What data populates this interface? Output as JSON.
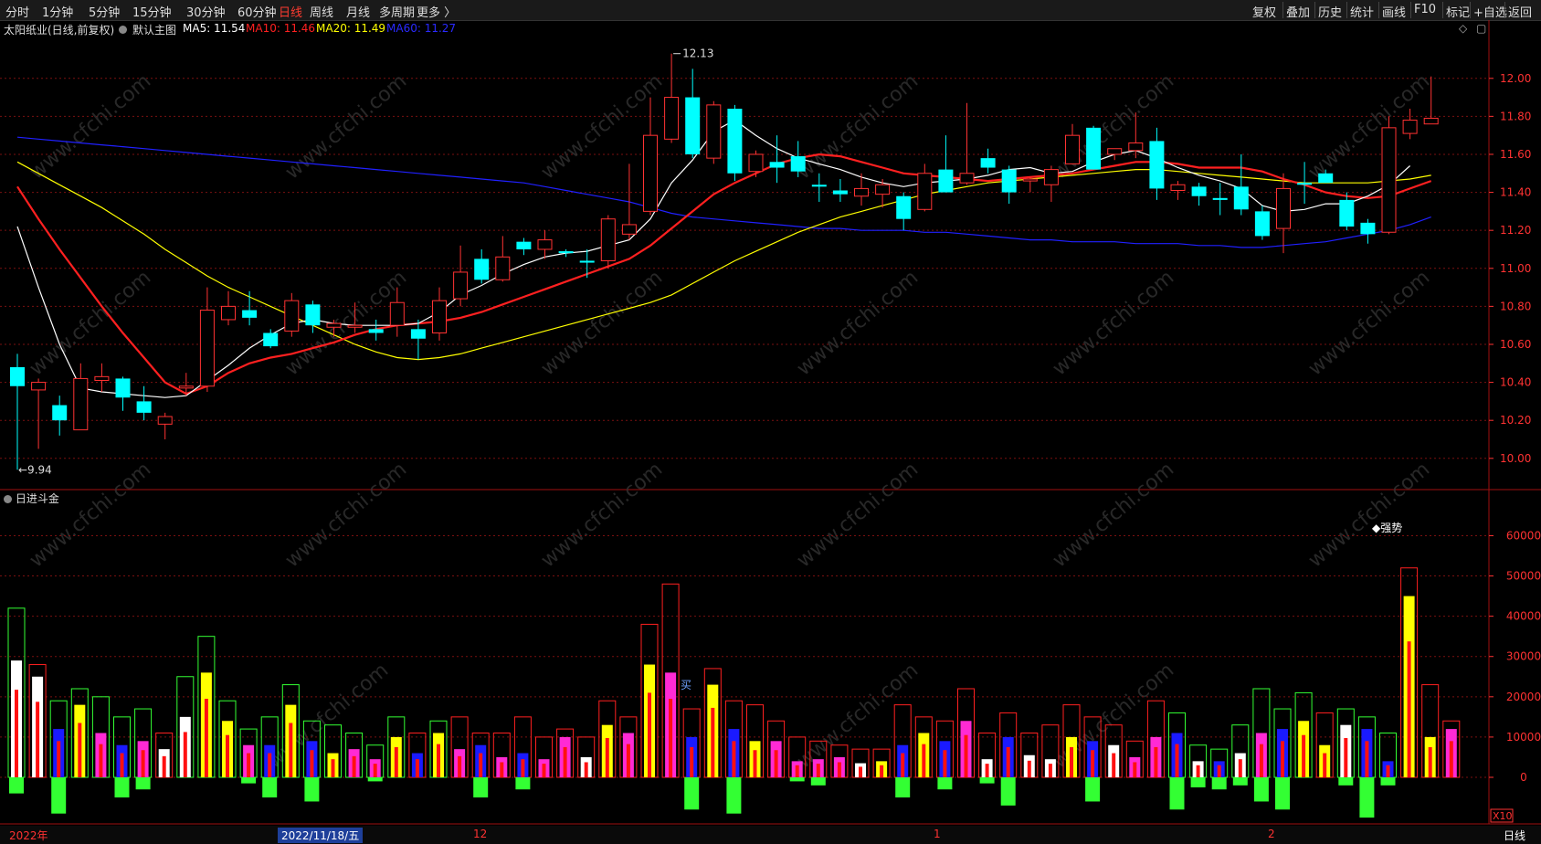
{
  "toolbar": {
    "periods": [
      "分时",
      "1分钟",
      "5分钟",
      "15分钟",
      "30分钟",
      "60分钟",
      "日线",
      "周线",
      "月线",
      "多周期",
      "更多 〉"
    ],
    "active_period": "日线",
    "right_items": [
      "复权",
      "叠加",
      "历史",
      "统计",
      "画线",
      "F10",
      "标记",
      "+自选",
      "返回"
    ]
  },
  "info": {
    "stock": "太阳纸业(日线,前复权)",
    "main_chart": "默认主图",
    "ma5": "MA5: 11.54",
    "ma10": "MA10: 11.46",
    "ma20": "MA20: 11.49",
    "ma60": "MA60: 11.27"
  },
  "colors": {
    "up": "#ff3232",
    "down": "#00ffff",
    "ma5": "#ffffff",
    "ma10": "#ff2020",
    "ma20": "#ffff00",
    "ma60": "#2020ff",
    "grid": "#7a1010",
    "axis": "#ff3232"
  },
  "price_axis": {
    "labels": [
      "12.00",
      "11.80",
      "11.60",
      "11.40",
      "11.20",
      "11.00",
      "10.80",
      "10.60",
      "10.40",
      "10.20",
      "10.00"
    ],
    "max_label": "12.13",
    "min_label": "9.94"
  },
  "indicator": {
    "title": "日进斗金",
    "axis_labels": [
      "60000",
      "50000",
      "40000",
      "30000",
      "20000",
      "10000",
      "0"
    ],
    "strong_label": "◆强势",
    "buy_label": "买"
  },
  "bottom": {
    "year": "2022年",
    "selected_date": "2022/11/18/五",
    "month_12": "12",
    "month_1": "1",
    "month_2": "2",
    "x10": "X10",
    "period": "日线"
  },
  "watermark": "www.cfchi.com",
  "chart_data": {
    "type": "candlestick",
    "ylim": [
      9.85,
      12.22
    ],
    "candles": [
      {
        "o": 10.48,
        "h": 10.55,
        "l": 9.94,
        "c": 10.38
      },
      {
        "o": 10.36,
        "h": 10.42,
        "l": 10.05,
        "c": 10.4
      },
      {
        "o": 10.28,
        "h": 10.33,
        "l": 10.12,
        "c": 10.2
      },
      {
        "o": 10.15,
        "h": 10.5,
        "l": 10.15,
        "c": 10.42
      },
      {
        "o": 10.41,
        "h": 10.5,
        "l": 10.35,
        "c": 10.43
      },
      {
        "o": 10.42,
        "h": 10.43,
        "l": 10.25,
        "c": 10.32
      },
      {
        "o": 10.3,
        "h": 10.38,
        "l": 10.2,
        "c": 10.24
      },
      {
        "o": 10.18,
        "h": 10.24,
        "l": 10.1,
        "c": 10.22
      },
      {
        "o": 10.37,
        "h": 10.45,
        "l": 10.33,
        "c": 10.38
      },
      {
        "o": 10.38,
        "h": 10.9,
        "l": 10.35,
        "c": 10.78
      },
      {
        "o": 10.73,
        "h": 10.88,
        "l": 10.7,
        "c": 10.8
      },
      {
        "o": 10.78,
        "h": 10.88,
        "l": 10.7,
        "c": 10.74
      },
      {
        "o": 10.66,
        "h": 10.68,
        "l": 10.58,
        "c": 10.59
      },
      {
        "o": 10.67,
        "h": 10.87,
        "l": 10.64,
        "c": 10.83
      },
      {
        "o": 10.81,
        "h": 10.83,
        "l": 10.66,
        "c": 10.7
      },
      {
        "o": 10.69,
        "h": 10.73,
        "l": 10.64,
        "c": 10.71
      },
      {
        "o": 10.69,
        "h": 10.82,
        "l": 10.66,
        "c": 10.7
      },
      {
        "o": 10.68,
        "h": 10.73,
        "l": 10.62,
        "c": 10.66
      },
      {
        "o": 10.7,
        "h": 10.9,
        "l": 10.64,
        "c": 10.82
      },
      {
        "o": 10.68,
        "h": 10.73,
        "l": 10.52,
        "c": 10.63
      },
      {
        "o": 10.66,
        "h": 10.9,
        "l": 10.62,
        "c": 10.83
      },
      {
        "o": 10.84,
        "h": 11.12,
        "l": 10.8,
        "c": 10.98
      },
      {
        "o": 11.05,
        "h": 11.1,
        "l": 10.92,
        "c": 10.94
      },
      {
        "o": 10.94,
        "h": 11.17,
        "l": 10.93,
        "c": 11.06
      },
      {
        "o": 11.14,
        "h": 11.16,
        "l": 11.07,
        "c": 11.1
      },
      {
        "o": 11.1,
        "h": 11.2,
        "l": 11.05,
        "c": 11.15
      },
      {
        "o": 11.09,
        "h": 11.1,
        "l": 11.06,
        "c": 11.08
      },
      {
        "o": 11.04,
        "h": 11.1,
        "l": 10.95,
        "c": 11.03
      },
      {
        "o": 11.04,
        "h": 11.28,
        "l": 11.0,
        "c": 11.26
      },
      {
        "o": 11.18,
        "h": 11.55,
        "l": 11.15,
        "c": 11.23
      },
      {
        "o": 11.3,
        "h": 11.9,
        "l": 11.28,
        "c": 11.7
      },
      {
        "o": 11.68,
        "h": 12.13,
        "l": 11.66,
        "c": 11.9
      },
      {
        "o": 11.9,
        "h": 12.05,
        "l": 11.58,
        "c": 11.6
      },
      {
        "o": 11.58,
        "h": 11.88,
        "l": 11.55,
        "c": 11.86
      },
      {
        "o": 11.84,
        "h": 11.86,
        "l": 11.46,
        "c": 11.5
      },
      {
        "o": 11.51,
        "h": 11.62,
        "l": 11.48,
        "c": 11.6
      },
      {
        "o": 11.56,
        "h": 11.7,
        "l": 11.45,
        "c": 11.53
      },
      {
        "o": 11.59,
        "h": 11.67,
        "l": 11.48,
        "c": 11.51
      },
      {
        "o": 11.44,
        "h": 11.5,
        "l": 11.35,
        "c": 11.43
      },
      {
        "o": 11.41,
        "h": 11.47,
        "l": 11.35,
        "c": 11.39
      },
      {
        "o": 11.38,
        "h": 11.5,
        "l": 11.33,
        "c": 11.42
      },
      {
        "o": 11.39,
        "h": 11.47,
        "l": 11.32,
        "c": 11.44
      },
      {
        "o": 11.38,
        "h": 11.4,
        "l": 11.2,
        "c": 11.26
      },
      {
        "o": 11.31,
        "h": 11.55,
        "l": 11.3,
        "c": 11.5
      },
      {
        "o": 11.52,
        "h": 11.7,
        "l": 11.4,
        "c": 11.4
      },
      {
        "o": 11.45,
        "h": 11.87,
        "l": 11.44,
        "c": 11.5
      },
      {
        "o": 11.58,
        "h": 11.63,
        "l": 11.5,
        "c": 11.53
      },
      {
        "o": 11.52,
        "h": 11.54,
        "l": 11.34,
        "c": 11.4
      },
      {
        "o": 11.46,
        "h": 11.48,
        "l": 11.4,
        "c": 11.47
      },
      {
        "o": 11.44,
        "h": 11.54,
        "l": 11.35,
        "c": 11.52
      },
      {
        "o": 11.55,
        "h": 11.76,
        "l": 11.55,
        "c": 11.7
      },
      {
        "o": 11.74,
        "h": 11.75,
        "l": 11.52,
        "c": 11.52
      },
      {
        "o": 11.6,
        "h": 11.63,
        "l": 11.57,
        "c": 11.63
      },
      {
        "o": 11.62,
        "h": 11.82,
        "l": 11.58,
        "c": 11.66
      },
      {
        "o": 11.67,
        "h": 11.74,
        "l": 11.36,
        "c": 11.42
      },
      {
        "o": 11.41,
        "h": 11.46,
        "l": 11.36,
        "c": 11.44
      },
      {
        "o": 11.43,
        "h": 11.45,
        "l": 11.33,
        "c": 11.38
      },
      {
        "o": 11.37,
        "h": 11.45,
        "l": 11.28,
        "c": 11.36
      },
      {
        "o": 11.43,
        "h": 11.6,
        "l": 11.28,
        "c": 11.31
      },
      {
        "o": 11.3,
        "h": 11.33,
        "l": 11.15,
        "c": 11.17
      },
      {
        "o": 11.21,
        "h": 11.5,
        "l": 11.08,
        "c": 11.42
      },
      {
        "o": 11.45,
        "h": 11.56,
        "l": 11.34,
        "c": 11.44
      },
      {
        "o": 11.5,
        "h": 11.52,
        "l": 11.45,
        "c": 11.45
      },
      {
        "o": 11.36,
        "h": 11.4,
        "l": 11.2,
        "c": 11.22
      },
      {
        "o": 11.24,
        "h": 11.26,
        "l": 11.13,
        "c": 11.18
      },
      {
        "o": 11.19,
        "h": 11.8,
        "l": 11.18,
        "c": 11.74
      },
      {
        "o": 11.71,
        "h": 11.84,
        "l": 11.68,
        "c": 11.78
      },
      {
        "o": 11.76,
        "h": 12.01,
        "l": 11.76,
        "c": 11.79
      }
    ],
    "ma5": [
      11.22,
      10.9,
      10.6,
      10.37,
      10.35,
      10.34,
      10.33,
      10.32,
      10.33,
      10.41,
      10.49,
      10.58,
      10.65,
      10.71,
      10.73,
      10.71,
      10.7,
      10.7,
      10.7,
      10.71,
      10.77,
      10.86,
      10.91,
      10.97,
      11.02,
      11.06,
      11.08,
      11.09,
      11.12,
      11.15,
      11.26,
      11.45,
      11.57,
      11.72,
      11.78,
      11.7,
      11.63,
      11.58,
      11.55,
      11.52,
      11.48,
      11.45,
      11.43,
      11.45,
      11.46,
      11.47,
      11.49,
      11.52,
      11.53,
      11.5,
      11.51,
      11.56,
      11.6,
      11.62,
      11.58,
      11.53,
      11.49,
      11.46,
      11.42,
      11.33,
      11.3,
      11.31,
      11.34,
      11.34,
      11.38,
      11.44,
      11.54
    ],
    "ma10": [
      11.43,
      11.26,
      11.1,
      10.95,
      10.8,
      10.66,
      10.53,
      10.4,
      10.34,
      10.38,
      10.45,
      10.5,
      10.53,
      10.55,
      10.58,
      10.61,
      10.65,
      10.68,
      10.7,
      10.71,
      10.72,
      10.74,
      10.77,
      10.81,
      10.85,
      10.89,
      10.93,
      10.97,
      11.01,
      11.05,
      11.12,
      11.21,
      11.3,
      11.39,
      11.45,
      11.5,
      11.55,
      11.58,
      11.6,
      11.59,
      11.56,
      11.53,
      11.5,
      11.49,
      11.48,
      11.47,
      11.46,
      11.47,
      11.48,
      11.49,
      11.5,
      11.52,
      11.54,
      11.56,
      11.56,
      11.55,
      11.53,
      11.53,
      11.53,
      11.51,
      11.47,
      11.44,
      11.4,
      11.38,
      11.37,
      11.38,
      11.42,
      11.46
    ],
    "ma20": [
      11.56,
      11.5,
      11.44,
      11.38,
      11.32,
      11.25,
      11.18,
      11.1,
      11.03,
      10.96,
      10.9,
      10.85,
      10.8,
      10.75,
      10.7,
      10.65,
      10.6,
      10.56,
      10.53,
      10.52,
      10.53,
      10.55,
      10.58,
      10.61,
      10.64,
      10.67,
      10.7,
      10.73,
      10.76,
      10.79,
      10.82,
      10.86,
      10.92,
      10.98,
      11.04,
      11.09,
      11.14,
      11.19,
      11.23,
      11.27,
      11.3,
      11.33,
      11.36,
      11.39,
      11.41,
      11.43,
      11.45,
      11.46,
      11.47,
      11.48,
      11.49,
      11.5,
      11.51,
      11.52,
      11.52,
      11.51,
      11.5,
      11.49,
      11.48,
      11.47,
      11.46,
      11.45,
      11.45,
      11.45,
      11.45,
      11.46,
      11.47,
      11.49
    ],
    "ma60": [
      11.69,
      11.68,
      11.67,
      11.66,
      11.65,
      11.64,
      11.63,
      11.62,
      11.61,
      11.6,
      11.59,
      11.58,
      11.57,
      11.56,
      11.55,
      11.54,
      11.53,
      11.52,
      11.51,
      11.5,
      11.49,
      11.48,
      11.47,
      11.46,
      11.45,
      11.43,
      11.41,
      11.39,
      11.37,
      11.35,
      11.32,
      11.29,
      11.27,
      11.26,
      11.25,
      11.24,
      11.23,
      11.22,
      11.21,
      11.21,
      11.2,
      11.2,
      11.2,
      11.19,
      11.19,
      11.18,
      11.17,
      11.16,
      11.15,
      11.15,
      11.14,
      11.14,
      11.14,
      11.13,
      11.13,
      11.13,
      11.12,
      11.12,
      11.11,
      11.11,
      11.12,
      11.13,
      11.14,
      11.16,
      11.18,
      11.2,
      11.23,
      11.27
    ],
    "indicator_bars": [
      {
        "box": 42000,
        "boxc": "g",
        "in": 29000,
        "inc": "w",
        "neg": 4000
      },
      {
        "box": 28000,
        "boxc": "r",
        "in": 25000,
        "inc": "w",
        "neg": 0
      },
      {
        "box": 19000,
        "boxc": "g",
        "in": 12000,
        "inc": "b",
        "neg": 9000
      },
      {
        "box": 22000,
        "boxc": "g",
        "in": 18000,
        "inc": "y",
        "neg": 0
      },
      {
        "box": 20000,
        "boxc": "g",
        "in": 11000,
        "inc": "m",
        "neg": 0
      },
      {
        "box": 15000,
        "boxc": "g",
        "in": 8000,
        "inc": "b",
        "neg": 5000
      },
      {
        "box": 17000,
        "boxc": "g",
        "in": 9000,
        "inc": "m",
        "neg": 3000
      },
      {
        "box": 11000,
        "boxc": "r",
        "in": 7000,
        "inc": "w",
        "neg": 0
      },
      {
        "box": 25000,
        "boxc": "g",
        "in": 15000,
        "inc": "w",
        "neg": 0
      },
      {
        "box": 35000,
        "boxc": "g",
        "in": 26000,
        "inc": "y",
        "neg": 0
      },
      {
        "box": 19000,
        "boxc": "g",
        "in": 14000,
        "inc": "y",
        "neg": 0
      },
      {
        "box": 12000,
        "boxc": "g",
        "in": 8000,
        "inc": "m",
        "neg": 1500
      },
      {
        "box": 15000,
        "boxc": "g",
        "in": 8000,
        "inc": "b",
        "neg": 5000
      },
      {
        "box": 23000,
        "boxc": "g",
        "in": 18000,
        "inc": "y",
        "neg": 0
      },
      {
        "box": 14000,
        "boxc": "g",
        "in": 9000,
        "inc": "b",
        "neg": 6000
      },
      {
        "box": 13000,
        "boxc": "g",
        "in": 6000,
        "inc": "y",
        "neg": 0
      },
      {
        "box": 11000,
        "boxc": "g",
        "in": 7000,
        "inc": "m",
        "neg": 0
      },
      {
        "box": 8000,
        "boxc": "g",
        "in": 4500,
        "inc": "m",
        "neg": 1000
      },
      {
        "box": 15000,
        "boxc": "g",
        "in": 10000,
        "inc": "y",
        "neg": 0
      },
      {
        "box": 11000,
        "boxc": "r",
        "in": 6000,
        "inc": "b",
        "neg": 0
      },
      {
        "box": 14000,
        "boxc": "g",
        "in": 11000,
        "inc": "y",
        "neg": 0
      },
      {
        "box": 15000,
        "boxc": "r",
        "in": 7000,
        "inc": "m",
        "neg": 0
      },
      {
        "box": 11000,
        "boxc": "r",
        "in": 8000,
        "inc": "b",
        "neg": 5000
      },
      {
        "box": 11000,
        "boxc": "r",
        "in": 5000,
        "inc": "m",
        "neg": 0
      },
      {
        "box": 15000,
        "boxc": "r",
        "in": 6000,
        "inc": "b",
        "neg": 3000
      },
      {
        "box": 10000,
        "boxc": "r",
        "in": 4500,
        "inc": "m",
        "neg": 0
      },
      {
        "box": 12000,
        "boxc": "r",
        "in": 10000,
        "inc": "m",
        "neg": 0
      },
      {
        "box": 10000,
        "boxc": "r",
        "in": 5000,
        "inc": "w",
        "neg": 0
      },
      {
        "box": 19000,
        "boxc": "r",
        "in": 13000,
        "inc": "y",
        "neg": 0
      },
      {
        "box": 15000,
        "boxc": "r",
        "in": 11000,
        "inc": "m",
        "neg": 0
      },
      {
        "box": 38000,
        "boxc": "r",
        "in": 28000,
        "inc": "y",
        "neg": 0
      },
      {
        "box": 48000,
        "boxc": "r",
        "in": 26000,
        "inc": "m",
        "neg": 0
      },
      {
        "box": 17000,
        "boxc": "r",
        "in": 10000,
        "inc": "b",
        "neg": 8000
      },
      {
        "box": 27000,
        "boxc": "r",
        "in": 23000,
        "inc": "y",
        "neg": 0
      },
      {
        "box": 19000,
        "boxc": "r",
        "in": 12000,
        "inc": "b",
        "neg": 9000
      },
      {
        "box": 18000,
        "boxc": "r",
        "in": 9000,
        "inc": "y",
        "neg": 0
      },
      {
        "box": 14000,
        "boxc": "r",
        "in": 9000,
        "inc": "m",
        "neg": 0
      },
      {
        "box": 10000,
        "boxc": "r",
        "in": 4000,
        "inc": "m",
        "neg": 1000
      },
      {
        "box": 9000,
        "boxc": "r",
        "in": 4500,
        "inc": "m",
        "neg": 2000
      },
      {
        "box": 8000,
        "boxc": "r",
        "in": 5000,
        "inc": "m",
        "neg": 0
      },
      {
        "box": 7000,
        "boxc": "r",
        "in": 3500,
        "inc": "w",
        "neg": 0
      },
      {
        "box": 7000,
        "boxc": "r",
        "in": 4000,
        "inc": "y",
        "neg": 0
      },
      {
        "box": 18000,
        "boxc": "r",
        "in": 8000,
        "inc": "b",
        "neg": 5000
      },
      {
        "box": 15000,
        "boxc": "r",
        "in": 11000,
        "inc": "y",
        "neg": 0
      },
      {
        "box": 14000,
        "boxc": "r",
        "in": 9000,
        "inc": "b",
        "neg": 3000
      },
      {
        "box": 22000,
        "boxc": "r",
        "in": 14000,
        "inc": "m",
        "neg": 0
      },
      {
        "box": 11000,
        "boxc": "r",
        "in": 4500,
        "inc": "w",
        "neg": 1500
      },
      {
        "box": 16000,
        "boxc": "r",
        "in": 10000,
        "inc": "b",
        "neg": 7000
      },
      {
        "box": 11000,
        "boxc": "r",
        "in": 5500,
        "inc": "w",
        "neg": 0
      },
      {
        "box": 13000,
        "boxc": "r",
        "in": 4500,
        "inc": "w",
        "neg": 0
      },
      {
        "box": 18000,
        "boxc": "r",
        "in": 10000,
        "inc": "y",
        "neg": 0
      },
      {
        "box": 15000,
        "boxc": "r",
        "in": 9000,
        "inc": "b",
        "neg": 6000
      },
      {
        "box": 13000,
        "boxc": "r",
        "in": 8000,
        "inc": "w",
        "neg": 0
      },
      {
        "box": 9000,
        "boxc": "r",
        "in": 5000,
        "inc": "m",
        "neg": 0
      },
      {
        "box": 19000,
        "boxc": "r",
        "in": 10000,
        "inc": "m",
        "neg": 0
      },
      {
        "box": 16000,
        "boxc": "g",
        "in": 11000,
        "inc": "b",
        "neg": 8000
      },
      {
        "box": 8000,
        "boxc": "g",
        "in": 4000,
        "inc": "w",
        "neg": 2500
      },
      {
        "box": 7000,
        "boxc": "g",
        "in": 4000,
        "inc": "b",
        "neg": 3000
      },
      {
        "box": 13000,
        "boxc": "g",
        "in": 6000,
        "inc": "w",
        "neg": 2000
      },
      {
        "box": 22000,
        "boxc": "g",
        "in": 11000,
        "inc": "m",
        "neg": 6000
      },
      {
        "box": 17000,
        "boxc": "g",
        "in": 12000,
        "inc": "b",
        "neg": 8000
      },
      {
        "box": 21000,
        "boxc": "g",
        "in": 14000,
        "inc": "y",
        "neg": 0
      },
      {
        "box": 16000,
        "boxc": "r",
        "in": 8000,
        "inc": "y",
        "neg": 0
      },
      {
        "box": 17000,
        "boxc": "g",
        "in": 13000,
        "inc": "w",
        "neg": 2000
      },
      {
        "box": 15000,
        "boxc": "g",
        "in": 12000,
        "inc": "b",
        "neg": 10000
      },
      {
        "box": 11000,
        "boxc": "g",
        "in": 4000,
        "inc": "b",
        "neg": 2000
      },
      {
        "box": 52000,
        "boxc": "r",
        "in": 45000,
        "inc": "y",
        "neg": 0
      },
      {
        "box": 23000,
        "boxc": "r",
        "in": 10000,
        "inc": "y",
        "neg": 0
      },
      {
        "box": 14000,
        "boxc": "r",
        "in": 12000,
        "inc": "m",
        "neg": 0
      }
    ]
  }
}
